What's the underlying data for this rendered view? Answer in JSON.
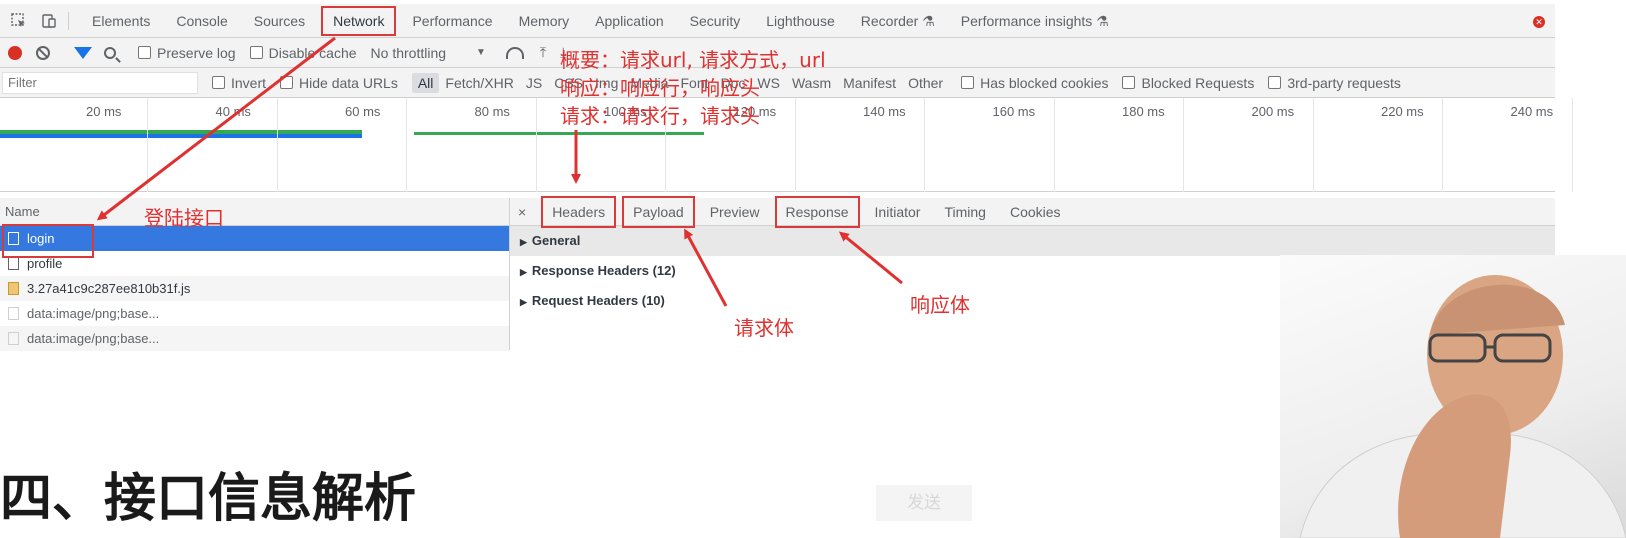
{
  "devtools": {
    "tabs": [
      "Elements",
      "Console",
      "Sources",
      "Network",
      "Performance",
      "Memory",
      "Application",
      "Security",
      "Lighthouse",
      "Recorder ⚗",
      "Performance insights ⚗"
    ],
    "active_tab": "Network",
    "toolbar": {
      "preserve_log": "Preserve log",
      "disable_cache": "Disable cache",
      "throttling": "No throttling"
    },
    "filter": {
      "placeholder": "Filter",
      "invert": "Invert",
      "hide_data_urls": "Hide data URLs",
      "types": [
        "All",
        "Fetch/XHR",
        "JS",
        "CSS",
        "Img",
        "Media",
        "Font",
        "Doc",
        "WS",
        "Wasm",
        "Manifest",
        "Other"
      ],
      "selected_type": "All",
      "has_blocked_cookies": "Has blocked cookies",
      "blocked_requests": "Blocked Requests",
      "third_party": "3rd-party requests"
    },
    "timeline": {
      "ticks": [
        "20 ms",
        "40 ms",
        "60 ms",
        "80 ms",
        "100 ms",
        "120 ms",
        "140 ms",
        "160 ms",
        "180 ms",
        "200 ms",
        "220 ms",
        "240 ms"
      ]
    },
    "requests": {
      "header": "Name",
      "rows": [
        "login",
        "profile",
        "3.27a41c9c287ee810b31f.js",
        "data:image/png;base...",
        "data:image/png;base..."
      ]
    },
    "detail": {
      "close": "×",
      "tabs": [
        "Headers",
        "Payload",
        "Preview",
        "Response",
        "Initiator",
        "Timing",
        "Cookies"
      ],
      "sections": [
        "General",
        "Response Headers (12)",
        "Request Headers (10)"
      ]
    }
  },
  "annotations": {
    "overview": "概要：请求url, 请求方式，url",
    "response": "响应：响应行，响应头",
    "request": "请求：请求行，请求头",
    "login_api": "登陆接口",
    "request_body": "请求体",
    "response_body": "响应体"
  },
  "slide": {
    "title": "四、接口信息解析",
    "send_button": "发送"
  },
  "colors": {
    "annotation_red": "#e03131",
    "selected_row": "#3478e0",
    "record": "#d93025"
  }
}
